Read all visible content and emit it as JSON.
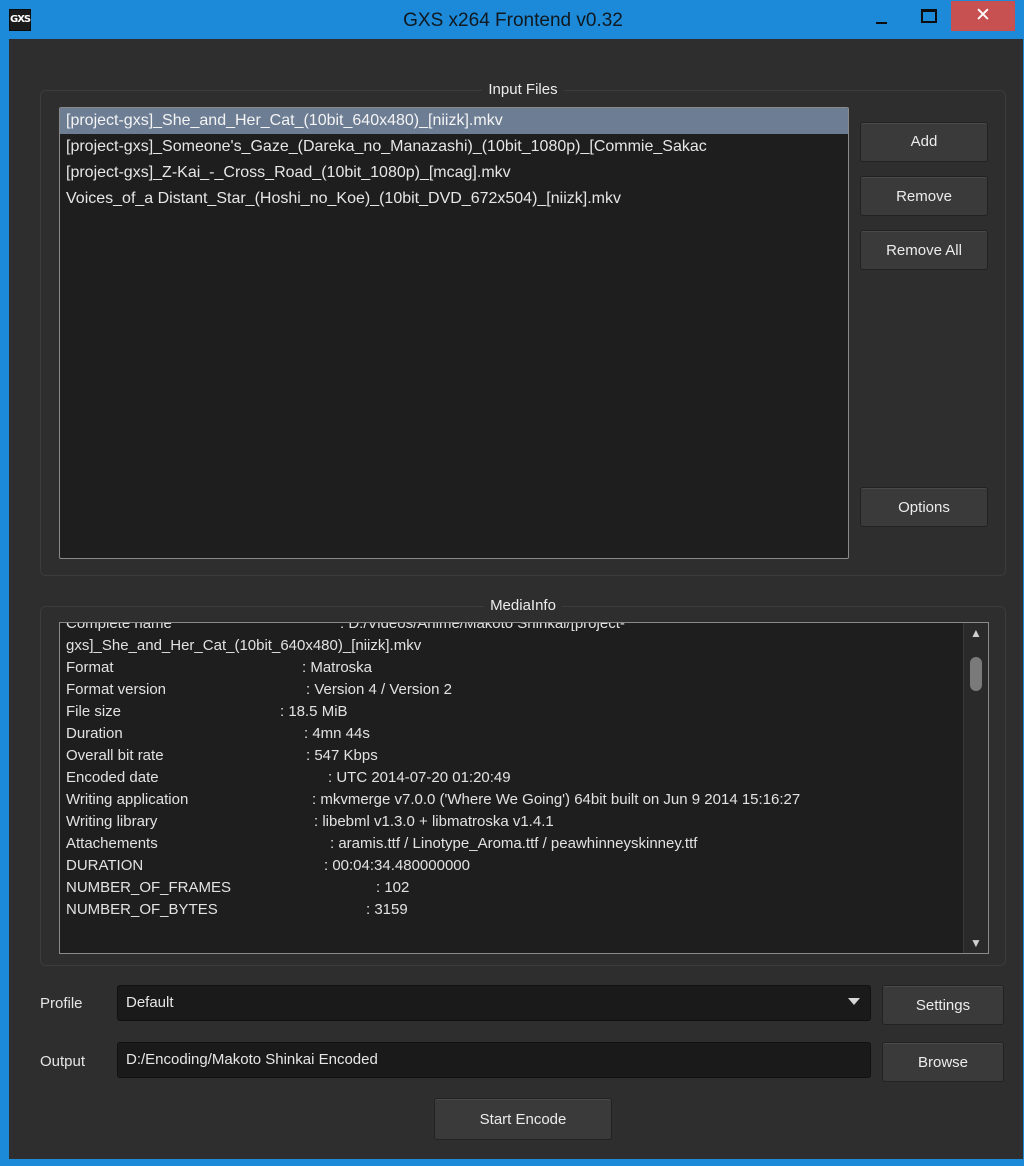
{
  "window": {
    "title": "GXS x264 Frontend v0.32",
    "app_icon_text": "GXS",
    "close_glyph": "✕"
  },
  "input_files": {
    "group_title": "Input Files",
    "files": [
      "[project-gxs]_She_and_Her_Cat_(10bit_640x480)_[niizk].mkv",
      "[project-gxs]_Someone's_Gaze_(Dareka_no_Manazashi)_(10bit_1080p)_[Commie_Sakac",
      "[project-gxs]_Z-Kai_-_Cross_Road_(10bit_1080p)_[mcag].mkv",
      "Voices_of_a Distant_Star_(Hoshi_no_Koe)_(10bit_DVD_672x504)_[niizk].mkv"
    ],
    "selected_index": 0,
    "buttons": {
      "add": "Add",
      "remove": "Remove",
      "remove_all": "Remove All",
      "options": "Options"
    }
  },
  "mediainfo": {
    "group_title": "MediaInfo",
    "lines": [
      {
        "key": "Complete name",
        "value": ": D:/Videos/Anime/Makoto Shinkai/[project-"
      },
      {
        "key": "gxs]_She_and_Her_Cat_(10bit_640x480)_[niizk].mkv",
        "value": ""
      },
      {
        "key": "Format",
        "value": ": Matroska"
      },
      {
        "key": "Format version",
        "value": ": Version 4 / Version 2"
      },
      {
        "key": "File size",
        "value": ": 18.5 MiB"
      },
      {
        "key": "Duration",
        "value": ": 4mn 44s"
      },
      {
        "key": "Overall bit rate",
        "value": ": 547 Kbps"
      },
      {
        "key": "Encoded date",
        "value": ": UTC 2014-07-20 01:20:49"
      },
      {
        "key": "Writing application",
        "value": ": mkvmerge v7.0.0 ('Where We Going') 64bit built on Jun  9 2014 15:16:27"
      },
      {
        "key": "Writing library",
        "value": ": libebml v1.3.0 + libmatroska v1.4.1"
      },
      {
        "key": "Attachements",
        "value": ": aramis.ttf / Linotype_Aroma.ttf / peawhinneyskinney.ttf"
      },
      {
        "key": "DURATION",
        "value": ": 00:04:34.480000000"
      },
      {
        "key": "NUMBER_OF_FRAMES",
        "value": ": 102"
      },
      {
        "key": "NUMBER_OF_BYTES",
        "value": ": 3159"
      }
    ],
    "scroll_up": "▲",
    "scroll_down": "▼"
  },
  "profile": {
    "label": "Profile",
    "value": "Default",
    "settings_button": "Settings"
  },
  "output": {
    "label": "Output",
    "value": "D:/Encoding/Makoto Shinkai Encoded",
    "browse_button": "Browse"
  },
  "start_encode_button": "Start Encode"
}
